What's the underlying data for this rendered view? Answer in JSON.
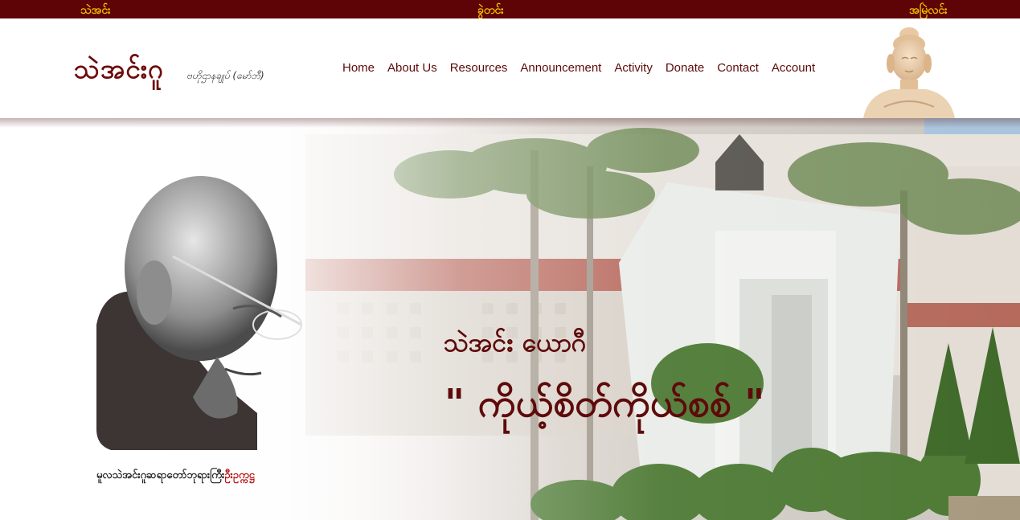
{
  "topbar": {
    "left": "သဲအင်း",
    "middle": "ခွဲတင်း",
    "right": "အမြဲလင်း"
  },
  "header": {
    "logo_title": "သဲအင်းဂူ",
    "logo_subtitle": "ဗဟိုဌာနချုပ် (မော်ဘီ)",
    "nav": [
      {
        "label": "Home"
      },
      {
        "label": "About Us"
      },
      {
        "label": "Resources"
      },
      {
        "label": "Announcement"
      },
      {
        "label": "Activity"
      },
      {
        "label": "Donate"
      },
      {
        "label": "Contact"
      },
      {
        "label": "Account"
      }
    ],
    "buddha_icon": "buddha-statue-image"
  },
  "hero": {
    "title": "သဲအင်း ယောဂီ",
    "quote": "\" ကိုယ့်စိတ်ကိုယ်စစ် \"",
    "caption_prefix": "မူလသဲအင်းဂူဆရာတော်ဘုရားကြီး",
    "caption_name": "ဦးဥက္ကဋ္ဌ"
  },
  "colors": {
    "topbar_bg": "#5e0306",
    "topbar_text": "#f2c200",
    "brand_maroon": "#5e0a0a",
    "caption_red": "#b40f0f"
  }
}
